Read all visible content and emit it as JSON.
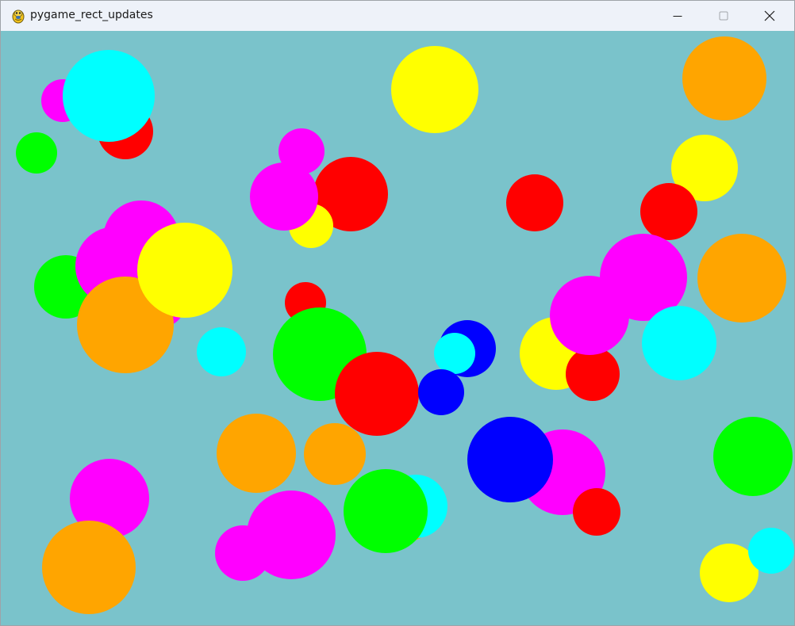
{
  "window": {
    "title": "pygame_rect_updates",
    "app_icon": "pygame-snake-icon",
    "controls": {
      "minimize_icon": "minimize-icon",
      "maximize_icon": "maximize-icon",
      "close_icon": "close-icon"
    }
  },
  "canvas": {
    "background": "#7ac3cb",
    "palette": {
      "red": "#ff0000",
      "green": "#00ff00",
      "blue": "#0000ff",
      "yellow": "#ffff00",
      "magenta": "#ff00ff",
      "cyan": "#00ffff",
      "orange": "#ffa500"
    }
  }
}
